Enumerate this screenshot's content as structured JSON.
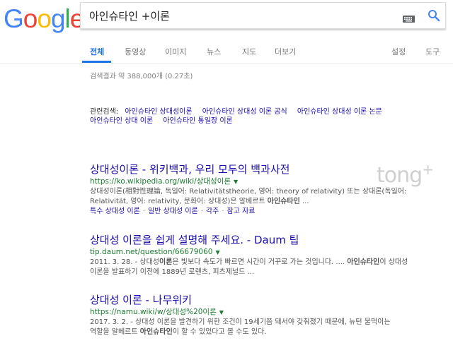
{
  "logo": {
    "letters": [
      "G",
      "o",
      "o",
      "g",
      "l",
      "e"
    ],
    "colors": [
      "#4285f4",
      "#ea4335",
      "#fbbc05",
      "#4285f4",
      "#34a853",
      "#ea4335"
    ]
  },
  "search": {
    "query": "아인슈타인 +이론",
    "keyboard_icon": "keyboard-icon",
    "search_icon": "magnifier-icon"
  },
  "tabs": {
    "items": [
      "전체",
      "동영상",
      "이미지",
      "뉴스",
      "지도",
      "더보기"
    ],
    "settings": "설정",
    "tools": "도구",
    "active_color": "#1a73e8"
  },
  "stats": "검색결과 약 388,000개 (0.27초)",
  "related": {
    "label": "관련검색:",
    "links": [
      "아인슈타인 상대성이론",
      "아인슈타인 상대성 이론 공식",
      "아인슈타인 상대성 이론 논문",
      "아인슈타인 상대 이론",
      "아인슈타인 통일장 이론"
    ]
  },
  "results": [
    {
      "title": "상대성이론 - 위키백과, 우리 모두의 백과사전",
      "url": "https://ko.wikipedia.org/wiki/상대성이론",
      "snippet1": "상대성이론(相對性理論, 독일어: Relativitätstheorie, 영어: theory of relativity) 또는 상대론(독일어:",
      "snippet2_pre": "Relativität, 영어: relativity, 문화어: 상대성)은 알베르트 ",
      "snippet2_bold": "아인슈타인",
      "snippet2_post": " ...",
      "sitelinks": [
        "특수 상대성 이론",
        "일반 상대성 이론",
        "각주",
        "참고 자료"
      ]
    },
    {
      "title": "상대성 이론을 쉽게 설명해 주세요. - Daum 팁",
      "url": "tip.daum.net/question/66679060",
      "snippet1_pre": "2011. 3. 28. - 상대성",
      "snippet1_bold": "이론",
      "snippet1_mid": "은 빛보다 속도가 빠르면 시간이 거꾸로 가는 것입니다. .... ",
      "snippet1_bold2": "아인슈타인",
      "snippet1_post": "이 상대성",
      "snippet2": "이론을 발표하기 이전에 1889년 로렌츠, 피츠제널드 ..."
    },
    {
      "title": "상대성 이론 - 나무위키",
      "url": "https://namu.wiki/w/상대성%20이론",
      "snippet1": "2017. 3. 2. - 상대성 이론을 발견하기 위한 조건이 19세기쯤 돼서야 갖춰졌기 때문에, 뉴턴 물먹이는",
      "snippet2_pre": "역할을 알베르트 ",
      "snippet2_bold": "아인슈타인",
      "snippet2_post": "이 할 수 있었다고 볼 수도 있다."
    }
  ],
  "watermark": {
    "text": "tong",
    "sup": "+"
  }
}
